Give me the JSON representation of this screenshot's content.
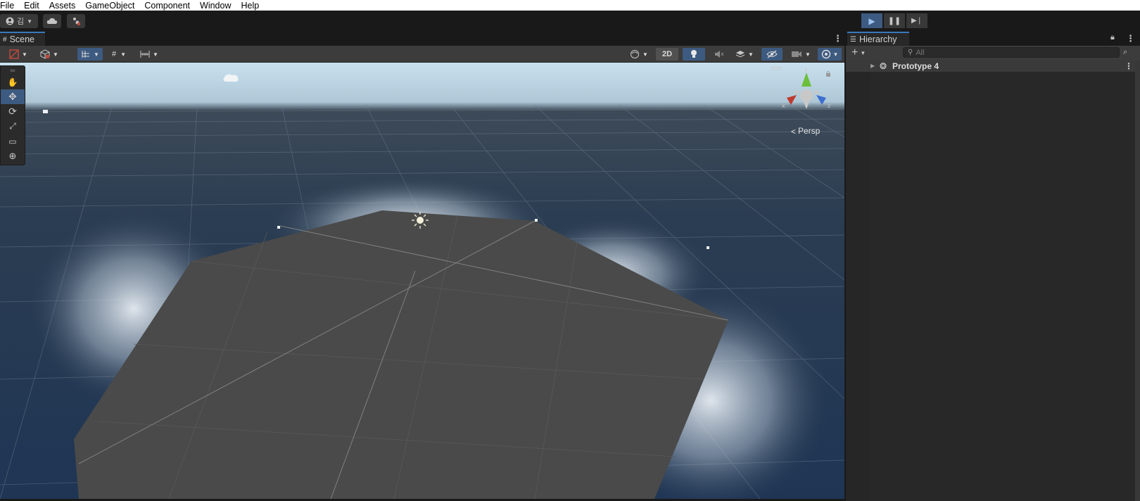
{
  "menu": [
    "File",
    "Edit",
    "Assets",
    "GameObject",
    "Component",
    "Window",
    "Help"
  ],
  "toolbar": {
    "account_label": "김",
    "play_icon": "play-icon",
    "pause_icon": "pause-icon",
    "step_icon": "step-icon"
  },
  "scene": {
    "tab_label": "Scene",
    "mode_2d_label": "2D",
    "projection_label": "Persp",
    "gizmo_axes": {
      "y": "y",
      "x": "x",
      "z": "z"
    }
  },
  "hierarchy": {
    "tab_label": "Hierarchy",
    "search_placeholder": "All",
    "root_item": "Prototype 4"
  },
  "colors": {
    "accent_blue": "#3d5a80",
    "tab_highlight": "#3a79bb",
    "panel_bg": "#282828",
    "sky": "#2c3e55",
    "ground": "#4a4a4a"
  }
}
